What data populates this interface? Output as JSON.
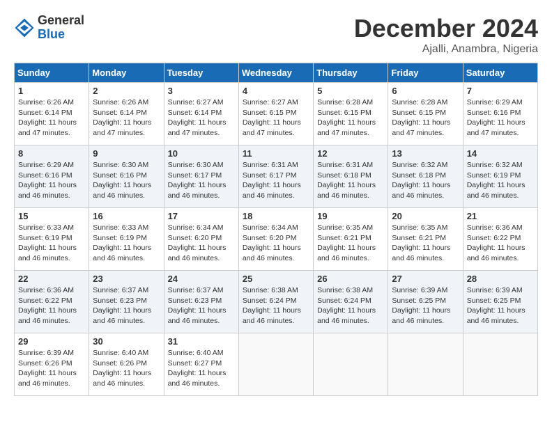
{
  "header": {
    "logo_general": "General",
    "logo_blue": "Blue",
    "month_title": "December 2024",
    "location": "Ajalli, Anambra, Nigeria"
  },
  "days_of_week": [
    "Sunday",
    "Monday",
    "Tuesday",
    "Wednesday",
    "Thursday",
    "Friday",
    "Saturday"
  ],
  "weeks": [
    [
      {
        "day": "1",
        "sunrise": "6:26 AM",
        "sunset": "6:14 PM",
        "daylight": "11 hours and 47 minutes."
      },
      {
        "day": "2",
        "sunrise": "6:26 AM",
        "sunset": "6:14 PM",
        "daylight": "11 hours and 47 minutes."
      },
      {
        "day": "3",
        "sunrise": "6:27 AM",
        "sunset": "6:14 PM",
        "daylight": "11 hours and 47 minutes."
      },
      {
        "day": "4",
        "sunrise": "6:27 AM",
        "sunset": "6:15 PM",
        "daylight": "11 hours and 47 minutes."
      },
      {
        "day": "5",
        "sunrise": "6:28 AM",
        "sunset": "6:15 PM",
        "daylight": "11 hours and 47 minutes."
      },
      {
        "day": "6",
        "sunrise": "6:28 AM",
        "sunset": "6:15 PM",
        "daylight": "11 hours and 47 minutes."
      },
      {
        "day": "7",
        "sunrise": "6:29 AM",
        "sunset": "6:16 PM",
        "daylight": "11 hours and 47 minutes."
      }
    ],
    [
      {
        "day": "8",
        "sunrise": "6:29 AM",
        "sunset": "6:16 PM",
        "daylight": "11 hours and 46 minutes."
      },
      {
        "day": "9",
        "sunrise": "6:30 AM",
        "sunset": "6:16 PM",
        "daylight": "11 hours and 46 minutes."
      },
      {
        "day": "10",
        "sunrise": "6:30 AM",
        "sunset": "6:17 PM",
        "daylight": "11 hours and 46 minutes."
      },
      {
        "day": "11",
        "sunrise": "6:31 AM",
        "sunset": "6:17 PM",
        "daylight": "11 hours and 46 minutes."
      },
      {
        "day": "12",
        "sunrise": "6:31 AM",
        "sunset": "6:18 PM",
        "daylight": "11 hours and 46 minutes."
      },
      {
        "day": "13",
        "sunrise": "6:32 AM",
        "sunset": "6:18 PM",
        "daylight": "11 hours and 46 minutes."
      },
      {
        "day": "14",
        "sunrise": "6:32 AM",
        "sunset": "6:19 PM",
        "daylight": "11 hours and 46 minutes."
      }
    ],
    [
      {
        "day": "15",
        "sunrise": "6:33 AM",
        "sunset": "6:19 PM",
        "daylight": "11 hours and 46 minutes."
      },
      {
        "day": "16",
        "sunrise": "6:33 AM",
        "sunset": "6:19 PM",
        "daylight": "11 hours and 46 minutes."
      },
      {
        "day": "17",
        "sunrise": "6:34 AM",
        "sunset": "6:20 PM",
        "daylight": "11 hours and 46 minutes."
      },
      {
        "day": "18",
        "sunrise": "6:34 AM",
        "sunset": "6:20 PM",
        "daylight": "11 hours and 46 minutes."
      },
      {
        "day": "19",
        "sunrise": "6:35 AM",
        "sunset": "6:21 PM",
        "daylight": "11 hours and 46 minutes."
      },
      {
        "day": "20",
        "sunrise": "6:35 AM",
        "sunset": "6:21 PM",
        "daylight": "11 hours and 46 minutes."
      },
      {
        "day": "21",
        "sunrise": "6:36 AM",
        "sunset": "6:22 PM",
        "daylight": "11 hours and 46 minutes."
      }
    ],
    [
      {
        "day": "22",
        "sunrise": "6:36 AM",
        "sunset": "6:22 PM",
        "daylight": "11 hours and 46 minutes."
      },
      {
        "day": "23",
        "sunrise": "6:37 AM",
        "sunset": "6:23 PM",
        "daylight": "11 hours and 46 minutes."
      },
      {
        "day": "24",
        "sunrise": "6:37 AM",
        "sunset": "6:23 PM",
        "daylight": "11 hours and 46 minutes."
      },
      {
        "day": "25",
        "sunrise": "6:38 AM",
        "sunset": "6:24 PM",
        "daylight": "11 hours and 46 minutes."
      },
      {
        "day": "26",
        "sunrise": "6:38 AM",
        "sunset": "6:24 PM",
        "daylight": "11 hours and 46 minutes."
      },
      {
        "day": "27",
        "sunrise": "6:39 AM",
        "sunset": "6:25 PM",
        "daylight": "11 hours and 46 minutes."
      },
      {
        "day": "28",
        "sunrise": "6:39 AM",
        "sunset": "6:25 PM",
        "daylight": "11 hours and 46 minutes."
      }
    ],
    [
      {
        "day": "29",
        "sunrise": "6:39 AM",
        "sunset": "6:26 PM",
        "daylight": "11 hours and 46 minutes."
      },
      {
        "day": "30",
        "sunrise": "6:40 AM",
        "sunset": "6:26 PM",
        "daylight": "11 hours and 46 minutes."
      },
      {
        "day": "31",
        "sunrise": "6:40 AM",
        "sunset": "6:27 PM",
        "daylight": "11 hours and 46 minutes."
      },
      null,
      null,
      null,
      null
    ]
  ],
  "labels": {
    "sunrise": "Sunrise:",
    "sunset": "Sunset:",
    "daylight": "Daylight:"
  }
}
